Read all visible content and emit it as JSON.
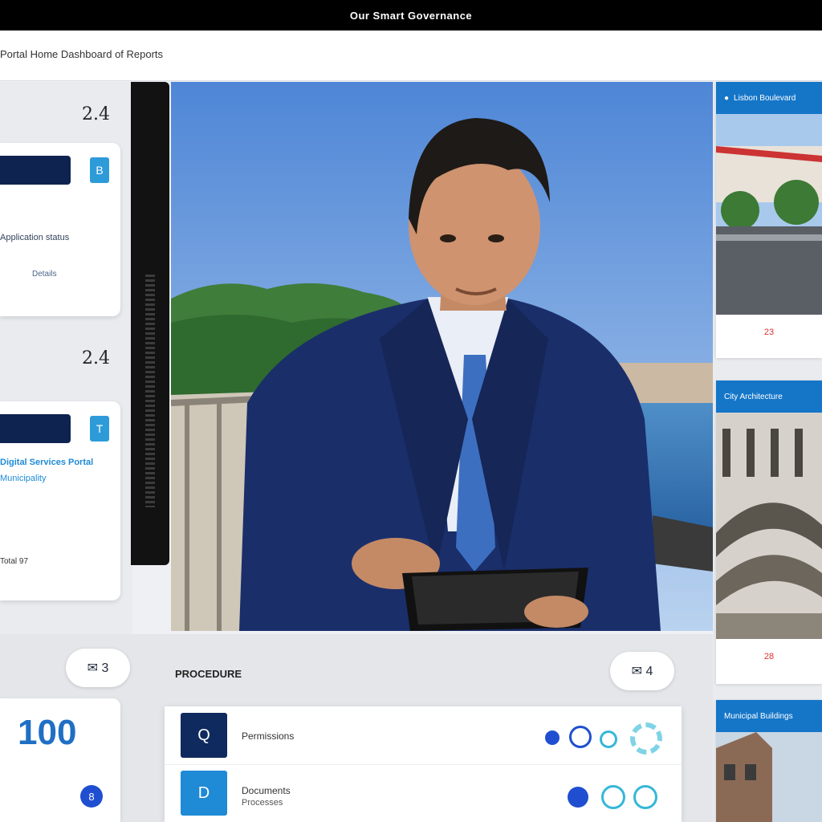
{
  "header": {
    "title": "Our Smart Governance"
  },
  "breadcrumb": "Portal Home  Dashboard of Reports",
  "left": {
    "metric_1": "2.4",
    "metric_2": "2.4",
    "card_1": {
      "line": "Application status",
      "sub": "Details",
      "chip": "B"
    },
    "card_2": {
      "line": "Digital Services Portal",
      "line2": "Municipality",
      "sub": "Total 97",
      "chip": "T"
    }
  },
  "right": {
    "tile_1": {
      "head": "Lisbon Boulevard",
      "foot": "23"
    },
    "tile_2": {
      "head": "City Architecture",
      "foot": "28"
    },
    "tile_3": {
      "head": "Municipal Buildings"
    }
  },
  "bottom": {
    "bubble_left": "✉ 3",
    "bubble_right": "✉ 4",
    "big_number": "100",
    "stat_dot": "8",
    "section_label": "PROCEDURE",
    "rows": [
      {
        "icon": "Q",
        "label": "Permissions",
        "sub": ""
      },
      {
        "icon": "D",
        "label": "Documents",
        "sub": "Processes"
      }
    ]
  },
  "colors": {
    "navy": "#0f2350",
    "accent": "#1576c8",
    "bright_blue": "#2e9bd9"
  }
}
